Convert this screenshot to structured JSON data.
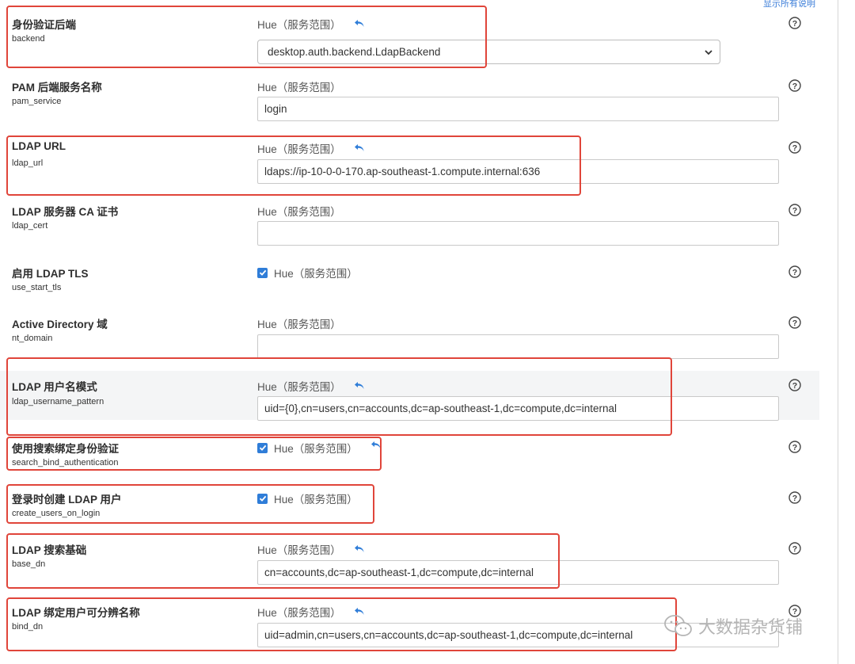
{
  "header": {
    "show_all_link": "显示所有说明"
  },
  "scope_text": "Hue（服务范围）",
  "rows": [
    {
      "label": "身份验证后端",
      "key": "backend",
      "type": "select",
      "value": "desktop.auth.backend.LdapBackend",
      "modified": true
    },
    {
      "label": "PAM 后端服务名称",
      "key": "pam_service",
      "type": "text",
      "value": "login",
      "modified": false
    },
    {
      "label": "LDAP URL",
      "key": "ldap_url",
      "type": "text",
      "value": "ldaps://ip-10-0-0-170.ap-southeast-1.compute.internal:636",
      "modified": true
    },
    {
      "label": "LDAP 服务器 CA 证书",
      "key": "ldap_cert",
      "type": "text",
      "value": "",
      "modified": false
    },
    {
      "label": "启用 LDAP TLS",
      "key": "use_start_tls",
      "type": "checkbox",
      "checked": true,
      "modified": false
    },
    {
      "label": "Active Directory 域",
      "key": "nt_domain",
      "type": "text",
      "value": "",
      "modified": false
    },
    {
      "label": "LDAP 用户名模式",
      "key": "ldap_username_pattern",
      "type": "text",
      "value": "uid={0},cn=users,cn=accounts,dc=ap-southeast-1,dc=compute,dc=internal",
      "modified": true
    },
    {
      "label": "使用搜索绑定身份验证",
      "key": "search_bind_authentication",
      "type": "checkbox",
      "checked": true,
      "modified": true
    },
    {
      "label": "登录时创建 LDAP 用户",
      "key": "create_users_on_login",
      "type": "checkbox",
      "checked": true,
      "modified": false
    },
    {
      "label": "LDAP 搜索基础",
      "key": "base_dn",
      "type": "text",
      "value": "cn=accounts,dc=ap-southeast-1,dc=compute,dc=internal",
      "modified": true
    },
    {
      "label": "LDAP 绑定用户可分辨名称",
      "key": "bind_dn",
      "type": "text",
      "value": "uid=admin,cn=users,cn=accounts,dc=ap-southeast-1,dc=compute,dc=internal",
      "modified": true
    }
  ],
  "watermark": "大数据杂货铺",
  "colors": {
    "accent": "#2f7dd8",
    "highlight_box": "#e0453a",
    "row_highlight": "#f4f5f6"
  }
}
